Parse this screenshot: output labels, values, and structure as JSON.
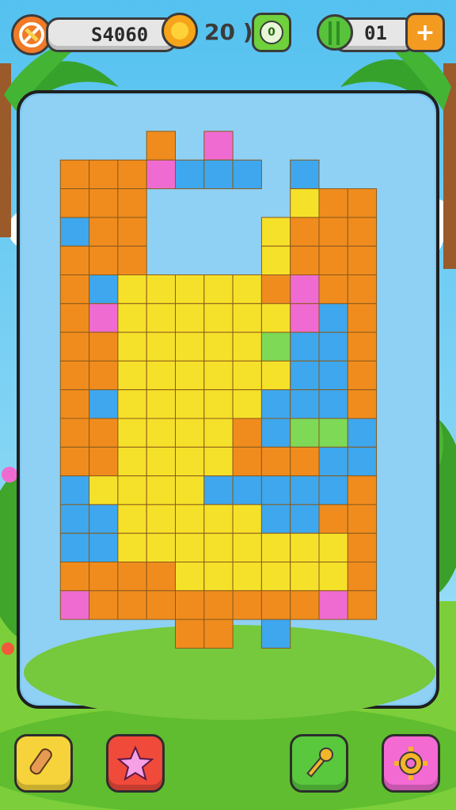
{
  "hud": {
    "score": "S4060",
    "coins": "20 )",
    "coin_badge": "0",
    "gems": "01",
    "add_symbol": "+"
  },
  "colors": {
    "orange": "#f08c1e",
    "yellow": "#f6e12a",
    "blue": "#3ea7ee",
    "purple": "#6f7ff0",
    "green": "#7ed957",
    "pink": "#f06bd1",
    "sky": "#61c8f1",
    "frame": "#1f1f1f"
  },
  "bottom_bar": {
    "buttons": [
      {
        "icon": "rolling-pin-icon",
        "color": "#f6d33b"
      },
      {
        "icon": "star-monster-icon",
        "color": "#f04a3a"
      },
      {
        "icon": "hammer-icon",
        "color": "#59c83d"
      },
      {
        "icon": "gear-icon",
        "color": "#f36ad3"
      }
    ]
  },
  "board": {
    "grid_rows": [
      "....O.P.....",
      ".OOOPBBB.B..",
      ".OOO.....YOO",
      ".BOO....YOOO",
      ".OOO....YOOO",
      ".OBYYYYYOPOO",
      ".OPYYYYYYPBO",
      ".OOYYYYYGBBO",
      ".OOYYYYYYBBO",
      ".OBYYYYYBBBO",
      ".OOYYYYOBGGB",
      ".OOYYYYOOOBB",
      ".BYYYYBBBBBO",
      ".BBYYYYYBBOO",
      ".BBYYYYYYYYO",
      ".OOOOYYYYYYO",
      ".POOOOOOOOPO",
      ".....OO.B..."
    ]
  }
}
